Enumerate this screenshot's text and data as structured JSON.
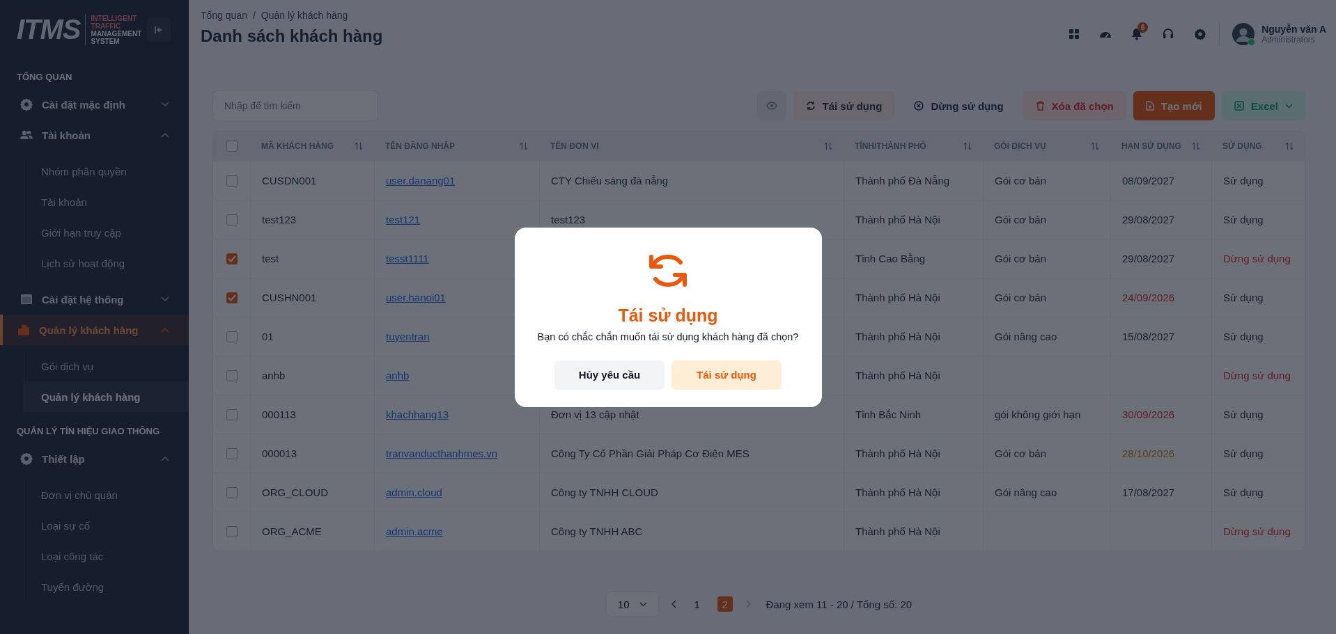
{
  "sidebar": {
    "logo": {
      "text": "ITMS",
      "tagline_1": "INTELLIGENT TRAFFIC",
      "tagline_2": "MANAGEMENT SYSTEM"
    },
    "sections": [
      {
        "title": "TỔNG QUAN",
        "items": [
          {
            "label": "Cài đặt mặc định",
            "expanded": false,
            "selected": false
          },
          {
            "label": "Tài khoản",
            "expanded": true,
            "selected": false,
            "children": [
              {
                "label": "Nhóm phân quyền",
                "selected": false
              },
              {
                "label": "Tài khoản",
                "selected": false
              },
              {
                "label": "Giới hạn truy cập",
                "selected": false
              },
              {
                "label": "Lịch sử hoạt động",
                "selected": false
              }
            ]
          },
          {
            "label": "Cài đặt hệ thống",
            "expanded": false,
            "selected": false
          },
          {
            "label": "Quản lý khách hàng",
            "expanded": true,
            "selected": true,
            "children": [
              {
                "label": "Gói dịch vụ",
                "selected": false
              },
              {
                "label": "Quản lý khách hàng",
                "selected": true
              }
            ]
          }
        ]
      },
      {
        "title": "QUẢN LÝ TÍN HIỆU GIAO THÔNG",
        "items": [
          {
            "label": "Thiết lập",
            "expanded": true,
            "selected": false,
            "children": [
              {
                "label": "Đơn vị chủ quản",
                "selected": false
              },
              {
                "label": "Loại sự cố",
                "selected": false
              },
              {
                "label": "Loại công tác",
                "selected": false
              },
              {
                "label": "Tuyến đường",
                "selected": false
              }
            ]
          }
        ]
      }
    ]
  },
  "header": {
    "breadcrumb": [
      "Tổng quan",
      "Quản lý khách hàng"
    ],
    "breadcrumb_separator": "/",
    "title": "Danh sách khách hàng",
    "notification_count": "6",
    "user": {
      "name": "Nguyễn văn A",
      "role": "Administrators",
      "online": true
    }
  },
  "toolbar": {
    "search": {
      "placeholder": "Nhập để tìm kiếm"
    },
    "buttons": [
      {
        "kind": "view"
      },
      {
        "kind": "reuse",
        "label": "Tái sử dụng"
      },
      {
        "kind": "stop",
        "label": "Dừng sử dụng"
      },
      {
        "kind": "delete",
        "label": "Xóa đã chọn"
      },
      {
        "kind": "create",
        "label": "Tạo mới"
      },
      {
        "kind": "excel",
        "label": "Excel"
      }
    ]
  },
  "table": {
    "select_all": false,
    "columns": [
      "MÃ KHÁCH HÀNG",
      "TÊN ĐĂNG NHẬP",
      "TÊN ĐƠN VỊ",
      "TỈNH/THÀNH PHỐ",
      "GÓI DỊCH VỤ",
      "HẠN SỬ DỤNG",
      "SỬ DỤNG"
    ],
    "rows": [
      {
        "checked": false,
        "code": "CUSDN001",
        "username": "user.danang01",
        "unit": "CTY Chiếu sáng đà nẵng",
        "province": "Thành phố Đà Nẵng",
        "package": "Gói cơ bản",
        "expiry": "08/09/2027",
        "expiry_warning": false,
        "expiry_danger": false,
        "status": "Sử dụng",
        "active": true
      },
      {
        "checked": false,
        "code": "test123",
        "username": "test121",
        "unit": "test123",
        "province": "Thành phố Hà Nội",
        "package": "Gói cơ bản",
        "expiry": "29/08/2027",
        "expiry_warning": false,
        "expiry_danger": false,
        "status": "Sử dụng",
        "active": true
      },
      {
        "checked": true,
        "code": "test",
        "username": "tesst1111",
        "province": "Tỉnh Cao Bằng",
        "package": "Gói cơ bản",
        "expiry": "29/08/2027",
        "expiry_warning": false,
        "expiry_danger": false,
        "status": "Dừng sử dụng",
        "active": false
      },
      {
        "checked": true,
        "code": "CUSHN001",
        "username": "user.hanoi01",
        "province": "Thành phố Hà Nội",
        "package": "Gói cơ bản",
        "expiry": "24/09/2026",
        "expiry_warning": false,
        "expiry_danger": true,
        "status": "Sử dụng",
        "active": true
      },
      {
        "checked": false,
        "code": "01",
        "username": "tuyentran",
        "province": "Thành phố Hà Nội",
        "package": "Gói nâng cao",
        "expiry": "15/08/2027",
        "expiry_warning": false,
        "expiry_danger": false,
        "status": "Sử dụng",
        "active": true
      },
      {
        "checked": false,
        "code": "anhb",
        "username": "anhb",
        "province": "Thành phố Hà Nội",
        "status": "Dừng sử dụng",
        "active": false
      },
      {
        "checked": false,
        "code": "000113",
        "username": "khachhang13",
        "unit": "Đơn vị 13 cập nhật",
        "province": "Tỉnh Bắc Ninh",
        "package": "gói không giới hạn",
        "expiry": "30/09/2026",
        "expiry_warning": false,
        "expiry_danger": true,
        "status": "Sử dụng",
        "active": true
      },
      {
        "checked": false,
        "code": "000013",
        "username": "tranvanducthanhmes.vn",
        "unit": "Công Ty Cổ Phần Giải Pháp Cơ Điện MES",
        "province": "Thành phố Hà Nội",
        "package": "Gói cơ bản",
        "expiry": "28/10/2026",
        "expiry_warning": true,
        "expiry_danger": false,
        "status": "Sử dụng",
        "active": true
      },
      {
        "checked": false,
        "code": "ORG_CLOUD",
        "username": "admin.cloud",
        "unit": "Công ty TNHH CLOUD",
        "province": "Thành phố Hà Nội",
        "package": "Gói nâng cao",
        "expiry": "17/08/2027",
        "expiry_warning": false,
        "expiry_danger": false,
        "status": "Sử dụng",
        "active": true
      },
      {
        "checked": false,
        "code": "ORG_ACME",
        "username": "admin.acme",
        "unit": "Công ty TNHH ABC",
        "province": "Thành phố Hà Nội",
        "status": "Dừng sử dụng",
        "active": false
      }
    ]
  },
  "pagination": {
    "page_size": "10",
    "pages": [
      {
        "label": "1",
        "selected": false
      },
      {
        "label": "2",
        "selected": true
      }
    ],
    "summary": "Đang xem 11 - 20 / Tổng số: 20"
  },
  "modal": {
    "title": "Tái sử dụng",
    "message": "Bạn có chắc chắn muốn tái sử dụng khách hàng đã chọn?",
    "cancel": "Hủy yêu cầu",
    "confirm": "Tái sử dụng"
  }
}
